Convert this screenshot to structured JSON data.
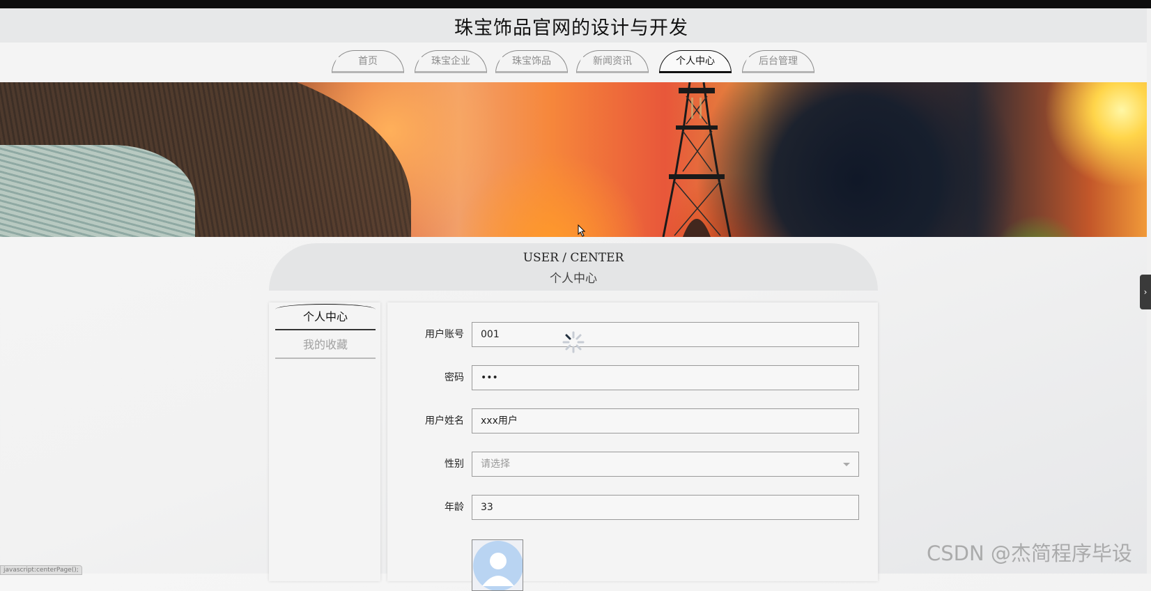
{
  "site": {
    "title": "珠宝饰品官网的设计与开发"
  },
  "nav": {
    "items": [
      {
        "label": "首页",
        "active": false
      },
      {
        "label": "珠宝企业",
        "active": false
      },
      {
        "label": "珠宝饰品",
        "active": false
      },
      {
        "label": "新闻资讯",
        "active": false
      },
      {
        "label": "个人中心",
        "active": true
      },
      {
        "label": "后台管理",
        "active": false
      }
    ]
  },
  "section": {
    "title_en": "USER / CENTER",
    "title_zh": "个人中心"
  },
  "sidebar": {
    "items": [
      {
        "label": "个人中心",
        "active": true
      },
      {
        "label": "我的收藏",
        "active": false
      }
    ]
  },
  "form": {
    "account": {
      "label": "用户账号",
      "value": "001"
    },
    "password": {
      "label": "密码",
      "value": "•••"
    },
    "name": {
      "label": "用户姓名",
      "value": "xxx用户"
    },
    "gender": {
      "label": "性别",
      "placeholder": "请选择"
    },
    "age": {
      "label": "年龄",
      "value": "33"
    }
  },
  "status_bar": {
    "url": "javascript:centerPage();"
  },
  "watermark": "CSDN @杰简程序毕设",
  "colors": {
    "active_tab": "#111111",
    "inactive_tab": "#8c8c8c",
    "header_bg": "#e7e8e9"
  }
}
